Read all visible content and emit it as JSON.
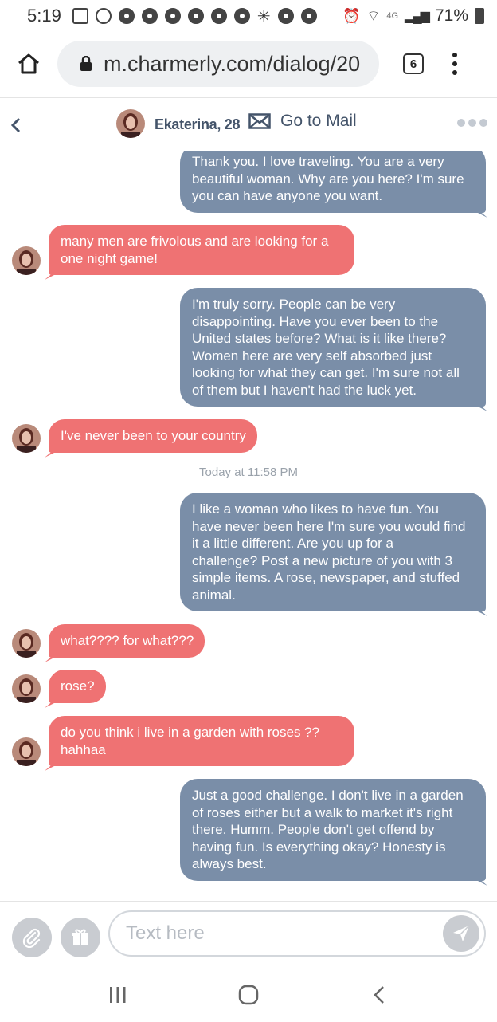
{
  "status_bar": {
    "time": "5:19",
    "network": "4G",
    "battery": "71%"
  },
  "browser": {
    "url": "m.charmerly.com/dialog/20",
    "tab_count": "6"
  },
  "chat_header": {
    "contact": "Ekaterina, 28",
    "mail_label": "Go to Mail"
  },
  "messages": [
    {
      "side": "out",
      "lines": [
        "Thank you. I love traveling. You are a very",
        "beautiful woman. Why are you here? I'm sure",
        "you can have anyone you want."
      ]
    },
    {
      "side": "in",
      "lines": [
        "many men are frivolous and are looking for a",
        "one night game!"
      ]
    },
    {
      "side": "out",
      "lines": [
        "I'm truly sorry. People can be very",
        "disappointing. Have you ever been to the",
        "United states before? What is it like there?",
        "Women here are very self absorbed just",
        "looking for what they can get. I'm sure not all",
        "of them but I haven't had the luck yet."
      ]
    },
    {
      "side": "in",
      "lines": [
        "I've never been to your country"
      ]
    },
    {
      "side": "out",
      "lines": [
        "I like a woman who likes to have fun. You",
        "have never been here I'm sure you would find",
        "it a little different. Are you up for a",
        "challenge? Post a new picture of you with 3",
        "simple items. A rose, newspaper, and stuffed",
        "animal."
      ]
    },
    {
      "side": "in",
      "lines": [
        "what???? for what???"
      ]
    },
    {
      "side": "in",
      "lines": [
        "rose?"
      ]
    },
    {
      "side": "in",
      "lines": [
        "do you think i live in a garden with roses ??",
        "hahhaa"
      ]
    },
    {
      "side": "out",
      "lines": [
        "Just a good challenge. I don't live in a garden",
        "of roses either but a walk to market it's right",
        "there. Humm. People don't get offend by",
        "having fun. Is everything okay? Honesty is",
        "always best."
      ]
    }
  ],
  "date_separator": "Today at 11:58 PM",
  "composer": {
    "placeholder": "Text here"
  },
  "colors": {
    "outgoing": "#7a8ea8",
    "incoming": "#ef7273",
    "header_text": "#44546a"
  }
}
